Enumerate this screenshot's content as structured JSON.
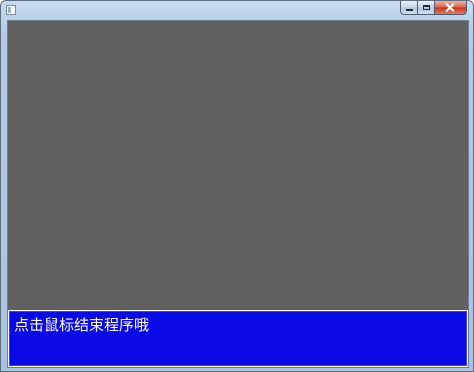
{
  "window": {
    "title": "",
    "caption_buttons": {
      "minimize_icon": "minimize-icon",
      "maximize_icon": "maximize-icon",
      "close_icon": "close-icon"
    }
  },
  "game_canvas": {
    "background_color": "#616161"
  },
  "message_box": {
    "text": "点击鼠标结束程序哦",
    "background_color": "#0a0ae6",
    "text_color": "#ffffff"
  }
}
